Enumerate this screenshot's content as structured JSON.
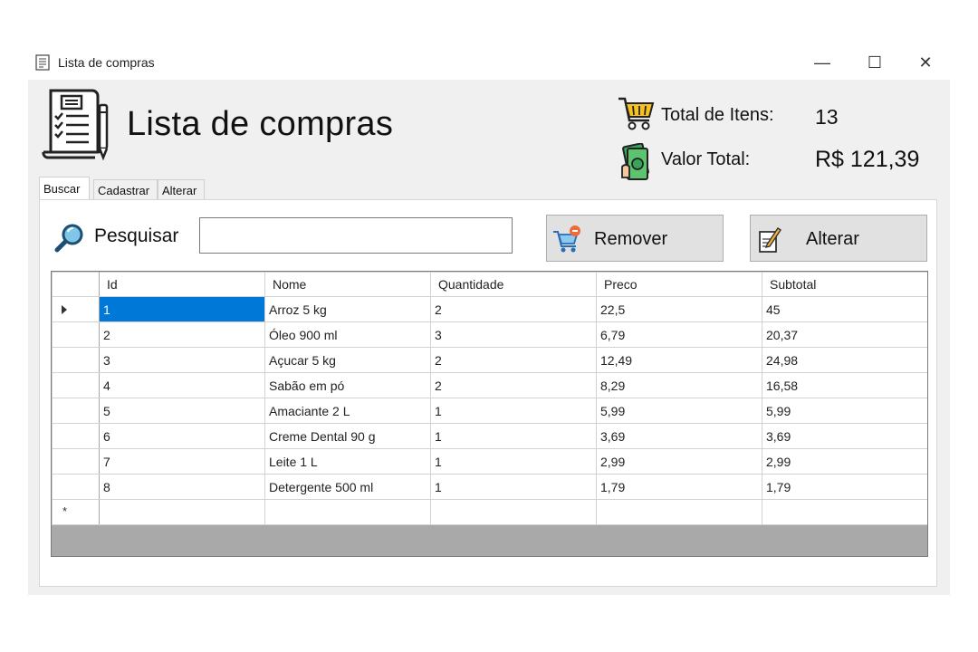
{
  "window": {
    "title": "Lista de compras",
    "controls": {
      "minimize": "—",
      "maximize": "☐",
      "close": "✕"
    }
  },
  "header": {
    "app_title": "Lista de compras",
    "total_items_label": "Total de Itens:",
    "total_items_value": "13",
    "total_value_label": "Valor Total:",
    "total_value_value": "R$ 121,39"
  },
  "tabs": [
    {
      "label": "Buscar",
      "active": true
    },
    {
      "label": "Cadastrar",
      "active": false
    },
    {
      "label": "Alterar",
      "active": false
    }
  ],
  "search": {
    "label": "Pesquisar",
    "value": "",
    "placeholder": ""
  },
  "buttons": {
    "remove": "Remover",
    "edit": "Alterar"
  },
  "table": {
    "columns": [
      "Id",
      "Nome",
      "Quantidade",
      "Preco",
      "Subtotal"
    ],
    "rows": [
      [
        "1",
        "Arroz 5 kg",
        "2",
        "22,5",
        "45"
      ],
      [
        "2",
        "Óleo 900 ml",
        "3",
        "6,79",
        "20,37"
      ],
      [
        "3",
        "Açucar 5 kg",
        "2",
        "12,49",
        "24,98"
      ],
      [
        "4",
        "Sabão em pó",
        "2",
        "8,29",
        "16,58"
      ],
      [
        "5",
        "Amaciante 2 L",
        "1",
        "5,99",
        "5,99"
      ],
      [
        "6",
        "Creme Dental 90 g",
        "1",
        "3,69",
        "3,69"
      ],
      [
        "7",
        "Leite 1 L",
        "1",
        "2,99",
        "2,99"
      ],
      [
        "8",
        "Detergente 500 ml",
        "1",
        "1,79",
        "1,79"
      ]
    ],
    "new_row_marker": "*"
  },
  "colors": {
    "selection": "#0078d7",
    "button_bg": "#e1e1e1",
    "window_bg": "#f0f0f0",
    "grid_empty_area": "#a9a9a9"
  },
  "icons": [
    "list-document-icon",
    "cart-icon",
    "money-icon",
    "search-icon",
    "cart-remove-icon",
    "edit-note-icon"
  ]
}
